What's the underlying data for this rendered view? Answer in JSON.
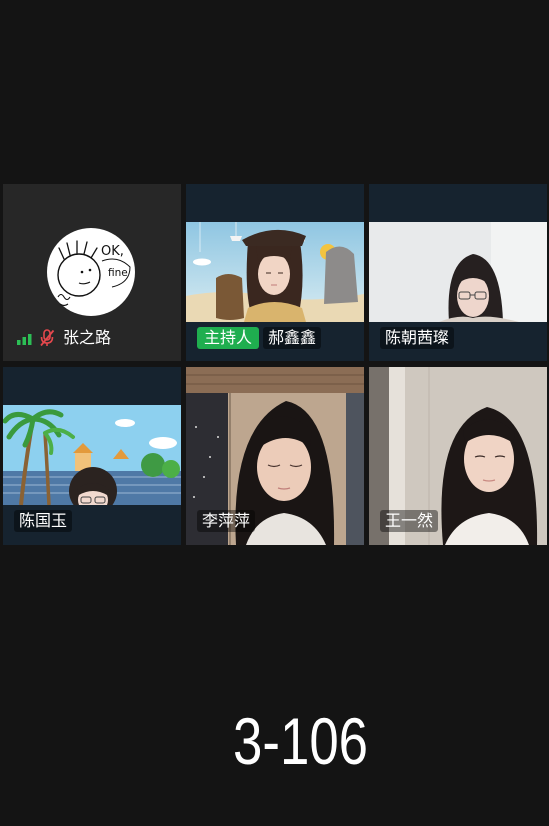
{
  "meeting": {
    "host_badge": "主持人",
    "participants": [
      {
        "name": "张之路",
        "video_on": false,
        "muted": true,
        "is_host": false,
        "signal_icon": "signal-bars-icon",
        "mic_icon": "mic-muted-icon",
        "avatar_lettering": [
          "OK,",
          "fine"
        ]
      },
      {
        "name": "郝鑫鑫",
        "video_on": true,
        "is_host": true
      },
      {
        "name": "陈朝茜璨",
        "video_on": true,
        "is_host": false
      },
      {
        "name": "陈国玉",
        "video_on": true,
        "is_host": false
      },
      {
        "name": "李萍萍",
        "video_on": true,
        "is_host": false
      },
      {
        "name": "王一然",
        "video_on": true,
        "is_host": false
      }
    ]
  },
  "caption": "3-106",
  "colors": {
    "background": "#141414",
    "tile": "#16232f",
    "camera_off_tile": "#272727",
    "host_badge": "#1fae4f",
    "muted_mic": "#e5484d",
    "signal": "#2cbf55"
  }
}
